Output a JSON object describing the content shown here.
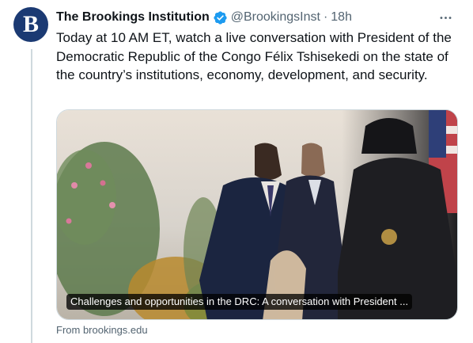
{
  "tweet": {
    "avatar_letter": "B",
    "display_name": "The Brookings Institution",
    "verified_icon": "verified-badge-icon",
    "handle": "@BrookingsInst",
    "separator": "·",
    "time": "18h",
    "more_icon": "more-icon",
    "text": "Today at 10 AM ET, watch a live conversation with President of the Democratic Republic of the Congo Félix Tshisekedi on the state of the country’s institutions, economy, development, and security."
  },
  "card": {
    "caption": "Challenges and opportunities in the DRC: A conversation with President ...",
    "source": "From brookings.edu"
  },
  "colors": {
    "text_primary": "#0f1419",
    "text_secondary": "#536471",
    "verified_blue": "#1d9bf0",
    "border": "#cfd9de",
    "avatar_bg": "#1b3a73"
  }
}
